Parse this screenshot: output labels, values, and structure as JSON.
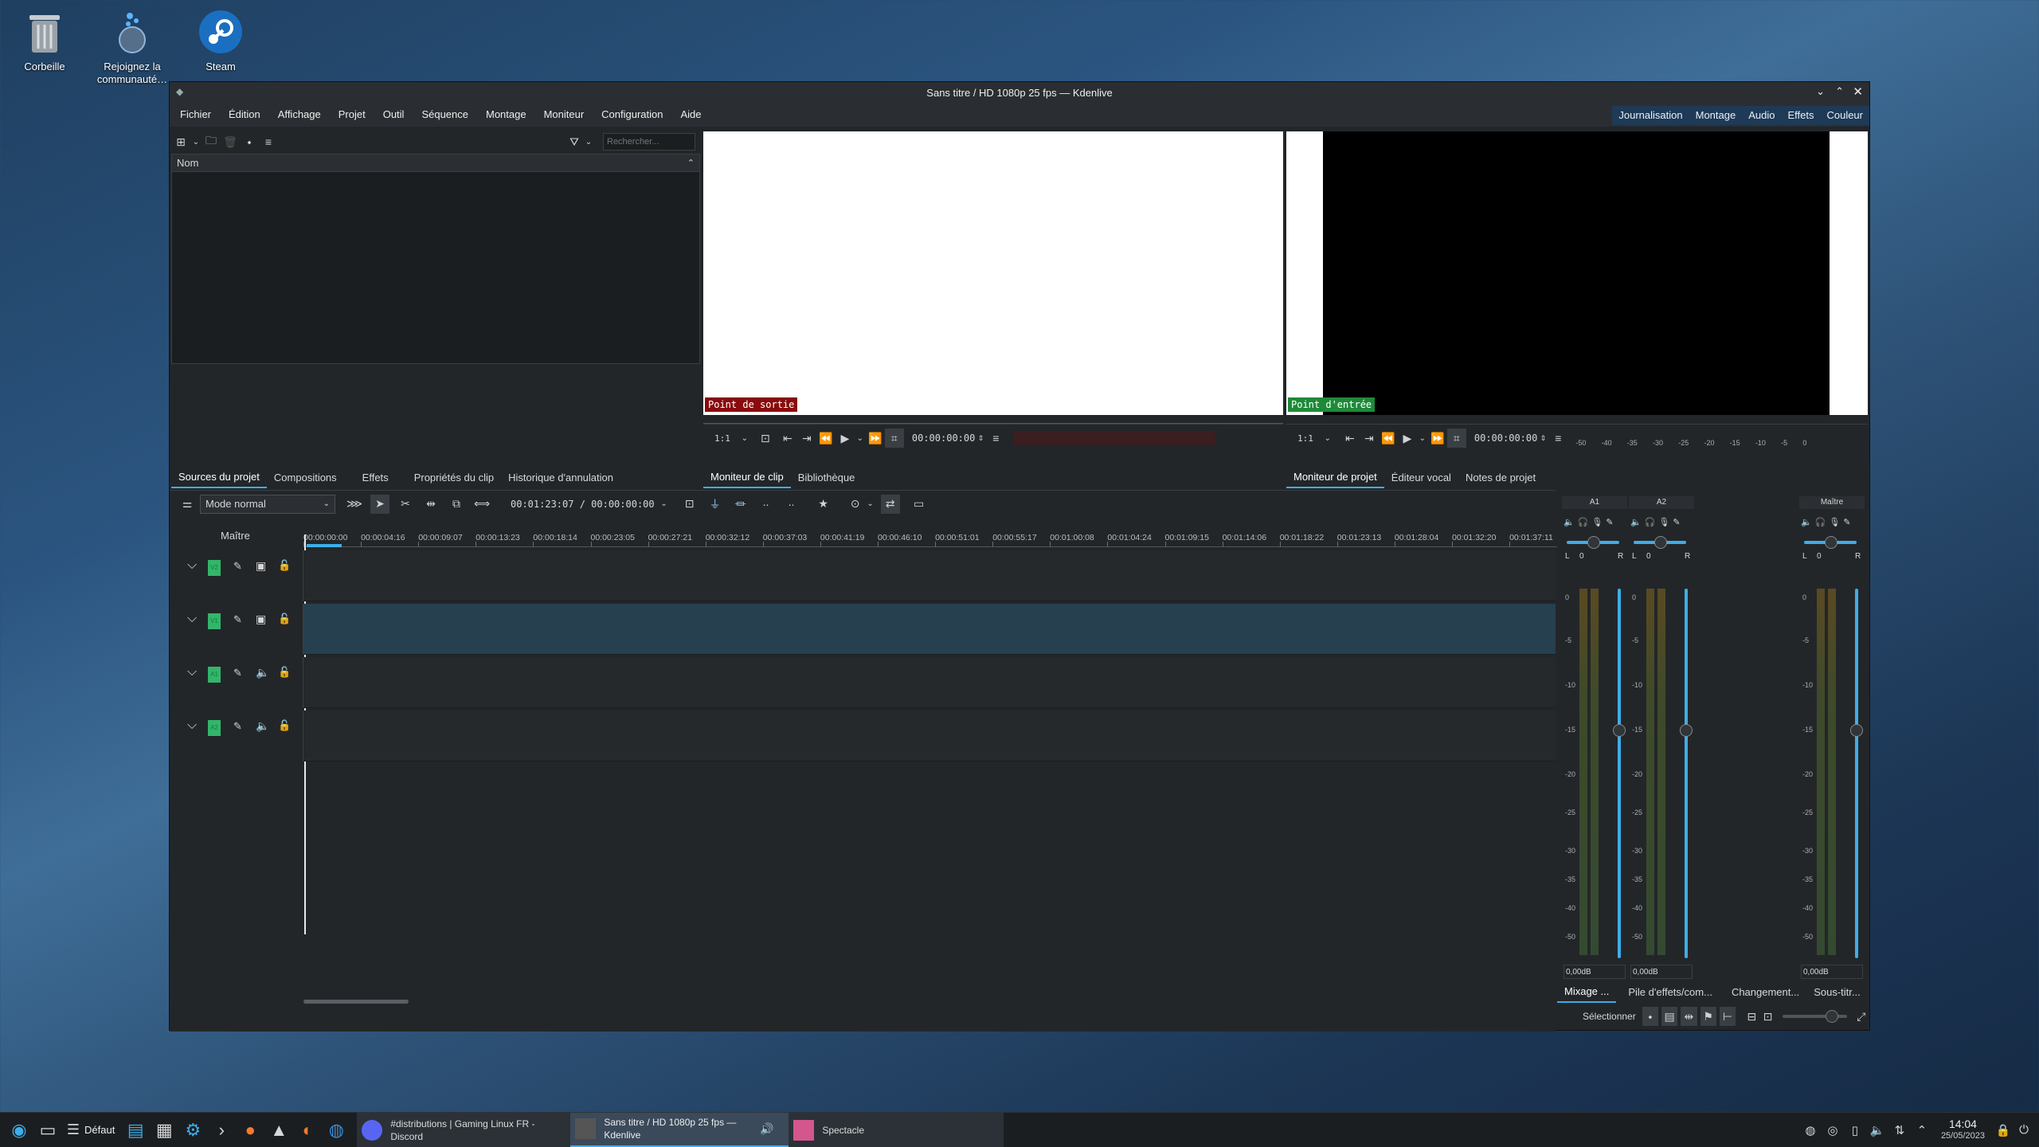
{
  "desktop": {
    "icons": [
      {
        "label": "Corbeille",
        "icon": "trash-icon"
      },
      {
        "label": "Rejoignez la communauté…",
        "icon": "community-icon"
      },
      {
        "label": "Steam",
        "icon": "steam-icon"
      }
    ]
  },
  "window": {
    "title": "Sans titre / HD 1080p 25 fps — Kdenlive",
    "menu": [
      "Fichier",
      "Édition",
      "Affichage",
      "Projet",
      "Outil",
      "Séquence",
      "Montage",
      "Moniteur",
      "Configuration",
      "Aide"
    ],
    "layouts": [
      "Journalisation",
      "Montage",
      "Audio",
      "Effets",
      "Couleur"
    ]
  },
  "bin": {
    "search_placeholder": "Rechercher...",
    "column_header": "Nom",
    "tabs": [
      "Sources du projet",
      "Compositions",
      "Effets",
      "Propriétés du clip",
      "Historique d'annulation"
    ]
  },
  "clip_monitor": {
    "overlay_label": "Point de sortie",
    "zoom": "1:1",
    "timecode": "00:00:00:00",
    "tabs": [
      "Moniteur de clip",
      "Bibliothèque"
    ]
  },
  "project_monitor": {
    "overlay_label": "Point d'entrée",
    "zoom": "1:1",
    "timecode": "00:00:00:00",
    "audio_scale": [
      "-50",
      "-40",
      "-35",
      "-30",
      "-25",
      "-20",
      "-15",
      "-10",
      "-5",
      "0"
    ],
    "tabs": [
      "Moniteur de projet",
      "Éditeur vocal",
      "Notes de projet"
    ]
  },
  "timeline": {
    "mode": "Mode normal",
    "timecode": "00:01:23:07 / 00:00:00:00",
    "master_label": "Maître",
    "ruler": [
      "00:00:00:00",
      "00:00:04:16",
      "00:00:09:07",
      "00:00:13:23",
      "00:00:18:14",
      "00:00:23:05",
      "00:00:27:21",
      "00:00:32:12",
      "00:00:37:03",
      "00:00:41:19",
      "00:00:46:10",
      "00:00:51:01",
      "00:00:55:17",
      "00:01:00:08",
      "00:01:04:24",
      "00:01:09:15",
      "00:01:14:06",
      "00:01:18:22",
      "00:01:23:13",
      "00:01:28:04",
      "00:01:32:20",
      "00:01:37:11"
    ],
    "tracks": [
      {
        "name": "V2",
        "kind": "video"
      },
      {
        "name": "V1",
        "kind": "video"
      },
      {
        "name": "A1",
        "kind": "audio"
      },
      {
        "name": "A2",
        "kind": "audio"
      }
    ]
  },
  "mixer": {
    "channels": [
      {
        "name": "A1",
        "gain": "0,00dB",
        "pan": "0"
      },
      {
        "name": "A2",
        "gain": "0,00dB",
        "pan": "0"
      },
      {
        "name": "Maître",
        "gain": "0,00dB",
        "pan": "0"
      }
    ],
    "scale": [
      "0",
      "-5",
      "-10",
      "-15",
      "-20",
      "-25",
      "-30",
      "-35",
      "-40",
      "-50"
    ],
    "left": "L",
    "right": "R",
    "tabs": [
      "Mixage ...",
      "Pile d'effets/com...",
      "Changement...",
      "Sous-titr..."
    ],
    "status_select": "Sélectionner"
  },
  "taskbar": {
    "desktop_label": "Défaut",
    "tasks": [
      {
        "label": "#distributions | Gaming Linux FR - Discord"
      },
      {
        "label": "Sans titre / HD 1080p 25 fps — Kdenlive"
      },
      {
        "label": "Spectacle"
      }
    ],
    "time": "14:04",
    "date": "25/05/2023"
  }
}
